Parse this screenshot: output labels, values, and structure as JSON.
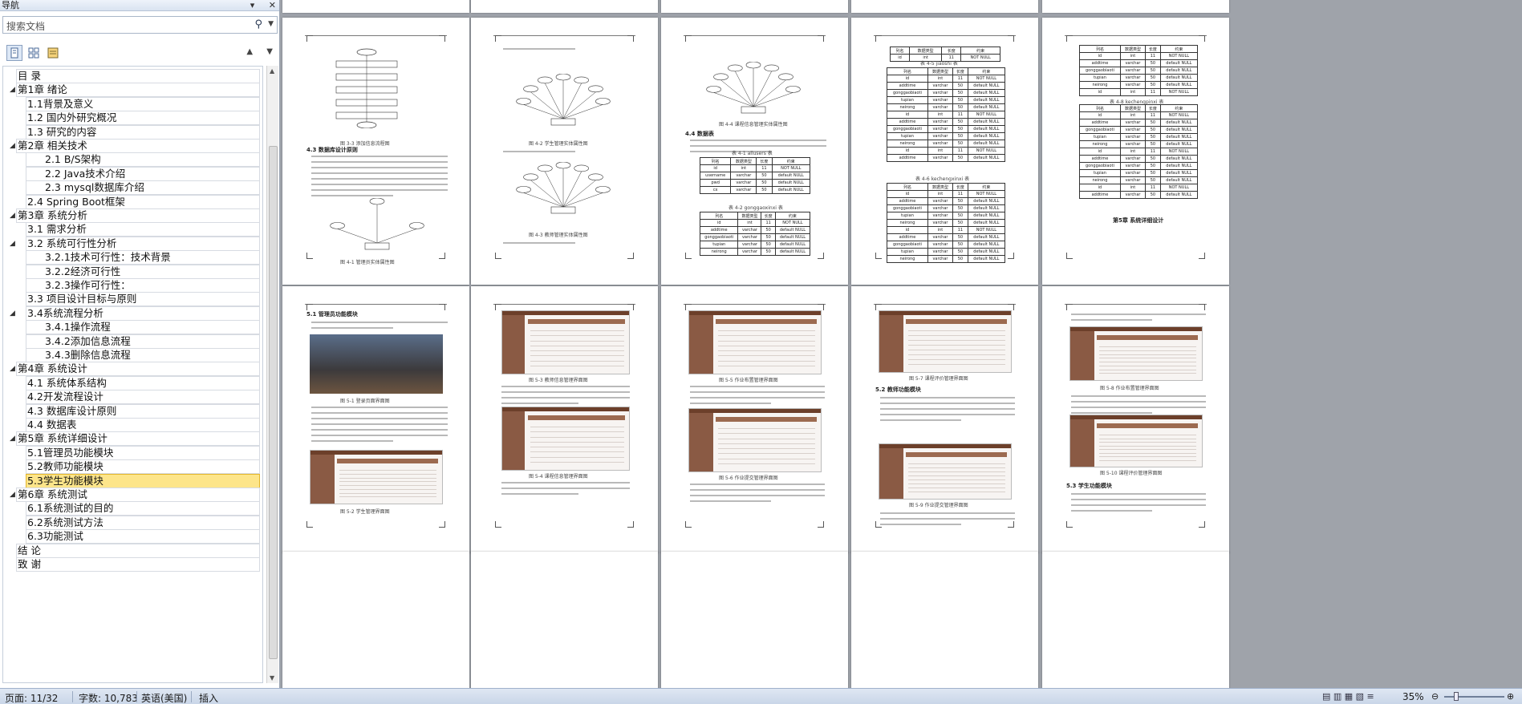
{
  "nav": {
    "title": "导航",
    "search_placeholder": "搜索文档",
    "items": [
      {
        "label": "目  录",
        "level": 1,
        "expand": ""
      },
      {
        "label": "第1章 绪论",
        "level": 1,
        "expand": "◢"
      },
      {
        "label": "1.1背景及意义",
        "level": 2,
        "expand": ""
      },
      {
        "label": "1.2 国内外研究概况",
        "level": 2,
        "expand": ""
      },
      {
        "label": "1.3 研究的内容",
        "level": 2,
        "expand": ""
      },
      {
        "label": "第2章 相关技术",
        "level": 1,
        "expand": "◢"
      },
      {
        "label": "2.1   B/S架构",
        "level": 3,
        "expand": ""
      },
      {
        "label": "2.2   Java技术介绍",
        "level": 3,
        "expand": ""
      },
      {
        "label": "2.3   mysql数据库介绍",
        "level": 3,
        "expand": ""
      },
      {
        "label": "2.4 Spring Boot框架",
        "level": 2,
        "expand": ""
      },
      {
        "label": "第3章 系统分析",
        "level": 1,
        "expand": "◢"
      },
      {
        "label": "3.1 需求分析",
        "level": 2,
        "expand": ""
      },
      {
        "label": "3.2 系统可行性分析",
        "level": 2,
        "expand": "◢"
      },
      {
        "label": "3.2.1技术可行性：技术背景",
        "level": 3,
        "expand": ""
      },
      {
        "label": "3.2.2经济可行性",
        "level": 3,
        "expand": ""
      },
      {
        "label": "3.2.3操作可行性：",
        "level": 3,
        "expand": ""
      },
      {
        "label": "3.3 项目设计目标与原则",
        "level": 2,
        "expand": ""
      },
      {
        "label": "3.4系统流程分析",
        "level": 2,
        "expand": "◢"
      },
      {
        "label": "3.4.1操作流程",
        "level": 3,
        "expand": ""
      },
      {
        "label": "3.4.2添加信息流程",
        "level": 3,
        "expand": ""
      },
      {
        "label": "3.4.3删除信息流程",
        "level": 3,
        "expand": ""
      },
      {
        "label": "第4章 系统设计",
        "level": 1,
        "expand": "◢"
      },
      {
        "label": "4.1 系统体系结构",
        "level": 2,
        "expand": ""
      },
      {
        "label": "4.2开发流程设计",
        "level": 2,
        "expand": ""
      },
      {
        "label": "4.3 数据库设计原则",
        "level": 2,
        "expand": ""
      },
      {
        "label": "4.4 数据表",
        "level": 2,
        "expand": ""
      },
      {
        "label": "第5章 系统详细设计",
        "level": 1,
        "expand": "◢"
      },
      {
        "label": "5.1管理员功能模块",
        "level": 2,
        "expand": ""
      },
      {
        "label": "5.2教师功能模块",
        "level": 2,
        "expand": ""
      },
      {
        "label": "5.3学生功能模块",
        "level": 2,
        "expand": "",
        "selected": true
      },
      {
        "label": "第6章  系统测试",
        "level": 1,
        "expand": "◢"
      },
      {
        "label": "6.1系统测试的目的",
        "level": 2,
        "expand": ""
      },
      {
        "label": "6.2系统测试方法",
        "level": 2,
        "expand": ""
      },
      {
        "label": "6.3功能测试",
        "level": 2,
        "expand": ""
      },
      {
        "label": "结  论",
        "level": 1,
        "expand": ""
      },
      {
        "label": "致  谢",
        "level": 1,
        "expand": ""
      }
    ]
  },
  "pages": {
    "headings": {
      "p1_section": "4.3 数据库设计原则",
      "p3_section": "4.4 数据表",
      "p5_chapter": "第5章 系统详细设计",
      "p6_section": "5.1 管理员功能模块",
      "p9_section": "5.2 教师功能模块",
      "p10_section": "5.3 学生功能模块"
    },
    "table_caption_1": "表 4-1 allusers 表",
    "table_caption_2": "表 4-2 gonggaoxinxi 表",
    "table_caption_3": "表 4-5 jiaoshi 表",
    "table_caption_4": "表 4-6 kechengxinxi 表",
    "table_caption_5": "表 4-8 kechengpinxi 表",
    "table_header": [
      "列名",
      "数据类型",
      "长度",
      "约束"
    ],
    "table_rows_a": [
      [
        "id",
        "int",
        "11",
        "NOT NULL"
      ],
      [
        "username",
        "varchar",
        "50",
        "default NULL"
      ],
      [
        "pwd",
        "varchar",
        "50",
        "default NULL"
      ],
      [
        "cx",
        "varchar",
        "50",
        "default NULL"
      ]
    ],
    "table_rows_b": [
      [
        "id",
        "int",
        "11",
        "NOT NULL"
      ],
      [
        "addtime",
        "varchar",
        "50",
        "default NULL"
      ],
      [
        "gonggaobiaoti",
        "varchar",
        "50",
        "default NULL"
      ],
      [
        "tupian",
        "varchar",
        "50",
        "default NULL"
      ],
      [
        "neirong",
        "varchar",
        "50",
        "default NULL"
      ]
    ],
    "fig_captions": {
      "flow": "图 3-3 添加信息流程图",
      "er1": "图 4-1 管理员实体属性图",
      "er2": "图 4-2 学生管理实体属性图",
      "er3": "图 4-3 教师管理实体属性图",
      "er4": "图 4-4 课程信息管理实体属性图",
      "login": "图 5-1 登录页面界面图",
      "s2": "图 5-2 学生管理界面图",
      "s3": "图 5-3 教师信息管理界面图",
      "s4": "图 5-4 课程信息管理界面图",
      "s5": "图 5-5 作业布置管理界面图",
      "s6": "图 5-6 作业提交管理界面图",
      "s7": "图 5-7 课程评价管理界面图",
      "s8": "图 5-8 作业布置管理界面图",
      "s9": "图 5-9 作业提交管理界面图",
      "s10": "图 5-10 课程评价管理界面图"
    }
  },
  "status": {
    "page": "页面: 11/32",
    "words": "字数: 10,783",
    "lang": "英语(美国)",
    "mode": "插入",
    "zoom": "35%"
  }
}
